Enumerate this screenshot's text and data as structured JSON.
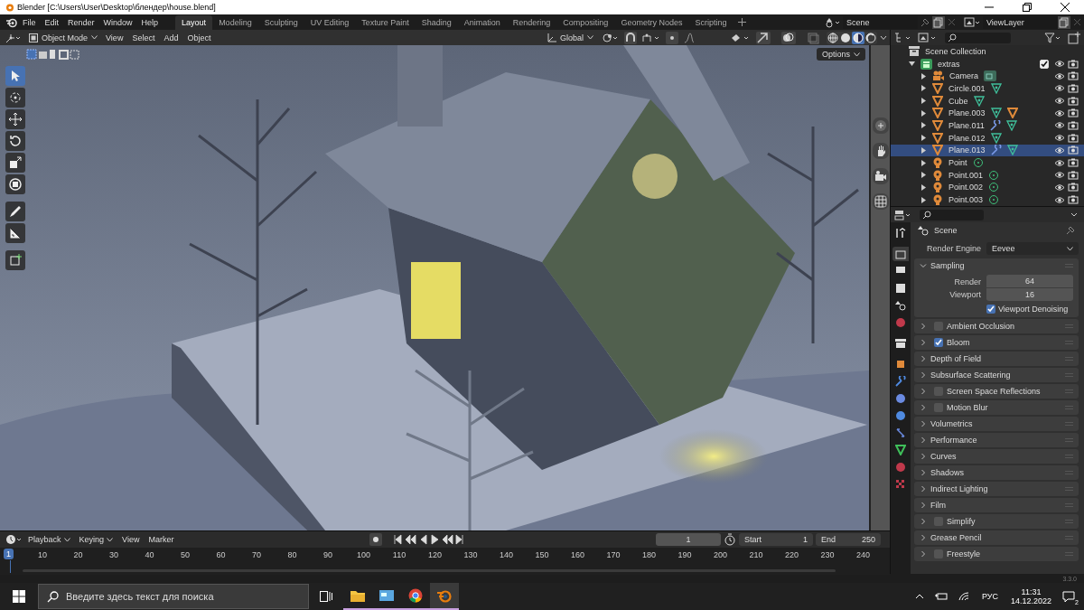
{
  "title_bar": {
    "title": "Blender [C:\\Users\\User\\Desktop\\блендер\\house.blend]"
  },
  "menu": [
    "File",
    "Edit",
    "Render",
    "Window",
    "Help"
  ],
  "workspaces": [
    {
      "label": "Layout",
      "selected": true
    },
    {
      "label": "Modeling",
      "selected": false
    },
    {
      "label": "Sculpting",
      "selected": false
    },
    {
      "label": "UV Editing",
      "selected": false
    },
    {
      "label": "Texture Paint",
      "selected": false
    },
    {
      "label": "Shading",
      "selected": false
    },
    {
      "label": "Animation",
      "selected": false
    },
    {
      "label": "Rendering",
      "selected": false
    },
    {
      "label": "Compositing",
      "selected": false
    },
    {
      "label": "Geometry Nodes",
      "selected": false
    },
    {
      "label": "Scripting",
      "selected": false
    }
  ],
  "scene": "Scene",
  "view_layer": "ViewLayer",
  "viewport_header": {
    "mode": "Object Mode",
    "menus": [
      "View",
      "Select",
      "Add",
      "Object"
    ],
    "orientation": "Global",
    "options": "Options",
    "shading": [
      {
        "kind": "wireframe",
        "selected": false
      },
      {
        "kind": "solid",
        "selected": false
      },
      {
        "kind": "material",
        "selected": true
      },
      {
        "kind": "rendered",
        "selected": false
      }
    ]
  },
  "tools": [
    {
      "kind": "select",
      "selected": true
    },
    {
      "kind": "cursor",
      "selected": false
    },
    {
      "kind": "move",
      "selected": false
    },
    {
      "kind": "rotate",
      "selected": false
    },
    {
      "kind": "scale",
      "selected": false
    },
    {
      "kind": "transform",
      "selected": false
    },
    {
      "kind": "annotate",
      "selected": false
    },
    {
      "kind": "measure",
      "selected": false
    },
    {
      "kind": "add-cube",
      "selected": false
    }
  ],
  "outliner": {
    "root": "Scene Collection",
    "collection": {
      "name": "extras",
      "checked": true,
      "expanded": true,
      "children": [
        {
          "name": "Camera",
          "kind": "camera",
          "selected": false,
          "data": [
            {
              "kind": "camera-data"
            }
          ]
        },
        {
          "name": "Circle.001",
          "kind": "mesh",
          "selected": false,
          "data": [
            {
              "kind": "mesh-data"
            }
          ]
        },
        {
          "name": "Cube",
          "kind": "mesh",
          "selected": false,
          "data": [
            {
              "kind": "mesh-data"
            }
          ]
        },
        {
          "name": "Plane.003",
          "kind": "mesh",
          "selected": false,
          "data": [
            {
              "kind": "mesh-data"
            },
            {
              "kind": "object"
            }
          ]
        },
        {
          "name": "Plane.011",
          "kind": "mesh",
          "selected": false,
          "data": [
            {
              "kind": "modifier"
            },
            {
              "kind": "mesh-data"
            }
          ]
        },
        {
          "name": "Plane.012",
          "kind": "mesh",
          "selected": false,
          "data": [
            {
              "kind": "mesh-data"
            }
          ]
        },
        {
          "name": "Plane.013",
          "kind": "mesh",
          "selected": true,
          "data": [
            {
              "kind": "modifier"
            },
            {
              "kind": "mesh-data"
            }
          ]
        },
        {
          "name": "Point",
          "kind": "light",
          "selected": false,
          "data": [
            {
              "kind": "light-data"
            }
          ]
        },
        {
          "name": "Point.001",
          "kind": "light",
          "selected": false,
          "data": [
            {
              "kind": "light-data"
            }
          ]
        },
        {
          "name": "Point.002",
          "kind": "light",
          "selected": false,
          "data": [
            {
              "kind": "light-data"
            }
          ]
        },
        {
          "name": "Point.003",
          "kind": "light",
          "selected": false,
          "data": [
            {
              "kind": "light-data"
            }
          ]
        }
      ]
    }
  },
  "properties": {
    "tabs": [
      {
        "kind": "tool",
        "selected": false
      },
      {
        "kind": "render",
        "selected": true
      },
      {
        "kind": "output",
        "selected": false
      },
      {
        "kind": "view-layer",
        "selected": false
      },
      {
        "kind": "scene",
        "selected": false
      },
      {
        "kind": "world",
        "selected": false
      },
      {
        "kind": "collection",
        "selected": false
      },
      {
        "kind": "object",
        "selected": false
      },
      {
        "kind": "modifier",
        "selected": false
      },
      {
        "kind": "particles",
        "selected": false
      },
      {
        "kind": "physics",
        "selected": false
      },
      {
        "kind": "constraints",
        "selected": false
      },
      {
        "kind": "data",
        "selected": false
      },
      {
        "kind": "material",
        "selected": false
      },
      {
        "kind": "texture",
        "selected": false
      }
    ],
    "context": "Scene",
    "engine_label": "Render Engine",
    "engine": "Eevee",
    "panels": [
      {
        "label": "Sampling",
        "kind": "plain",
        "expanded": true,
        "fields": [
          {
            "label": "Render",
            "value": "64"
          },
          {
            "label": "Viewport",
            "value": "16"
          }
        ],
        "option": {
          "label": "Viewport Denoising",
          "checked": true
        }
      },
      {
        "label": "Ambient Occlusion",
        "kind": "toggle",
        "checked": false,
        "expanded": false
      },
      {
        "label": "Bloom",
        "kind": "toggle",
        "checked": true,
        "expanded": false
      },
      {
        "label": "Depth of Field",
        "kind": "plain",
        "expanded": false
      },
      {
        "label": "Subsurface Scattering",
        "kind": "plain",
        "expanded": false
      },
      {
        "label": "Screen Space Reflections",
        "kind": "toggle",
        "checked": false,
        "expanded": false
      },
      {
        "label": "Motion Blur",
        "kind": "toggle",
        "checked": false,
        "expanded": false
      },
      {
        "label": "Volumetrics",
        "kind": "plain",
        "expanded": false
      },
      {
        "label": "Performance",
        "kind": "plain",
        "expanded": false
      },
      {
        "label": "Curves",
        "kind": "plain",
        "expanded": false
      },
      {
        "label": "Shadows",
        "kind": "plain",
        "expanded": false
      },
      {
        "label": "Indirect Lighting",
        "kind": "plain",
        "expanded": false
      },
      {
        "label": "Film",
        "kind": "plain",
        "expanded": false
      },
      {
        "label": "Simplify",
        "kind": "toggle",
        "checked": false,
        "expanded": false
      },
      {
        "label": "Grease Pencil",
        "kind": "plain",
        "expanded": false
      },
      {
        "label": "Freestyle",
        "kind": "toggle",
        "checked": false,
        "expanded": false
      }
    ]
  },
  "timeline": {
    "menus": [
      "Playback",
      "Keying",
      "View",
      "Marker"
    ],
    "current_frame": "1",
    "start_label": "Start",
    "start": "1",
    "end_label": "End",
    "end": "250",
    "playhead": "1",
    "ruler": [
      "10",
      "20",
      "30",
      "40",
      "50",
      "60",
      "70",
      "80",
      "90",
      "100",
      "110",
      "120",
      "130",
      "140",
      "150",
      "160",
      "170",
      "180",
      "190",
      "200",
      "210",
      "220",
      "230",
      "240"
    ]
  },
  "version": "3.3.0",
  "taskbar": {
    "search_placeholder": "Введите здесь текст для поиска",
    "apps": [
      {
        "kind": "folder",
        "selected": false
      },
      {
        "kind": "window",
        "selected": false
      },
      {
        "kind": "browser",
        "selected": false
      },
      {
        "kind": "blender",
        "selected": true
      }
    ],
    "language": "РУС",
    "time": "11:31",
    "date": "14.12.2022",
    "notifications": "2"
  }
}
